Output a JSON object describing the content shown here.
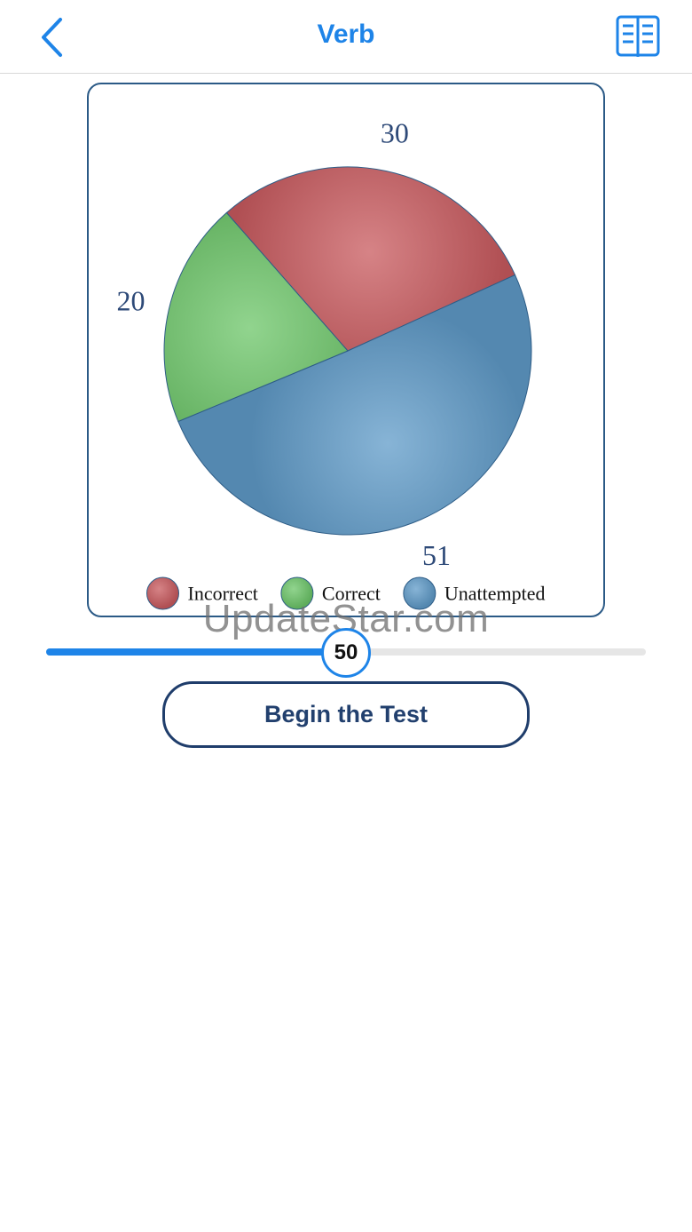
{
  "nav": {
    "title": "Verb",
    "back_icon": "chevron-left-icon",
    "book_icon": "open-book-icon",
    "accent_color": "#1e84e8"
  },
  "chart_data": {
    "type": "pie",
    "slices": [
      {
        "label": "Incorrect",
        "value": 30,
        "color": "#c85a5e"
      },
      {
        "label": "Unattempted",
        "value": 51,
        "color": "#5f9bc8"
      },
      {
        "label": "Correct",
        "value": 20,
        "color": "#6cc568"
      }
    ],
    "legend": [
      "Incorrect",
      "Correct",
      "Unattempted"
    ],
    "legend_position": "bottom"
  },
  "watermark": "UpdateStar.com",
  "slider": {
    "value": 50,
    "min": 0,
    "max": 100,
    "label": "50"
  },
  "begin_button": {
    "label": "Begin the Test"
  }
}
